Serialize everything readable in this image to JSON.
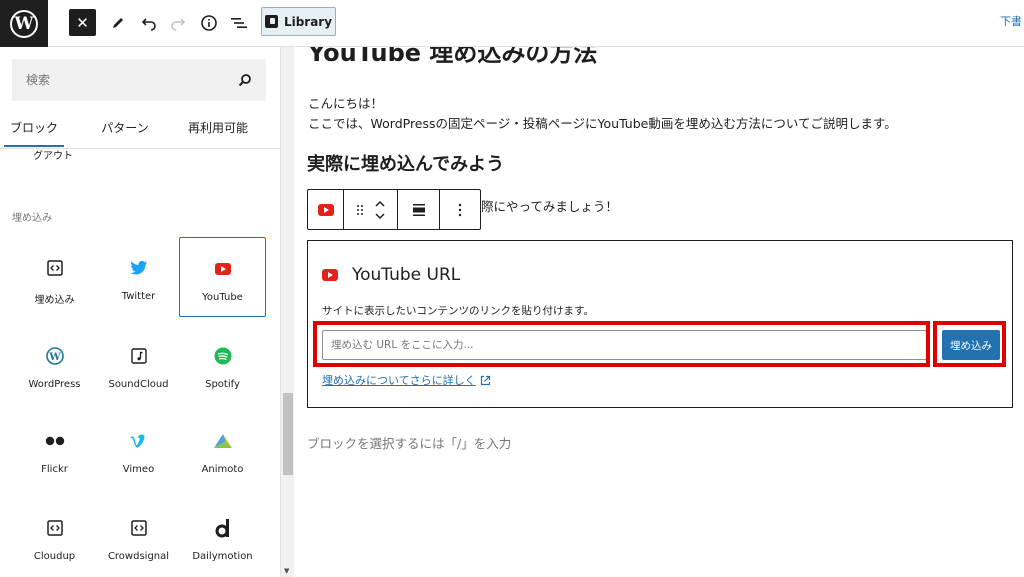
{
  "topbar": {
    "library_label": "Library",
    "draft_label": "下書"
  },
  "sidebar": {
    "search_placeholder": "検索",
    "tabs": [
      {
        "label": "ブロック",
        "active": true
      },
      {
        "label": "パターン",
        "active": false
      },
      {
        "label": "再利用可能",
        "active": false
      }
    ],
    "partial_label": "グアウト",
    "section_title": "埋め込み",
    "blocks": [
      {
        "label": "埋め込み",
        "icon": "embed-icon"
      },
      {
        "label": "Twitter",
        "icon": "twitter-icon"
      },
      {
        "label": "YouTube",
        "icon": "youtube-icon",
        "selected": true
      },
      {
        "label": "WordPress",
        "icon": "wordpress-icon"
      },
      {
        "label": "SoundCloud",
        "icon": "soundcloud-icon"
      },
      {
        "label": "Spotify",
        "icon": "spotify-icon"
      },
      {
        "label": "Flickr",
        "icon": "flickr-icon"
      },
      {
        "label": "Vimeo",
        "icon": "vimeo-icon"
      },
      {
        "label": "Animoto",
        "icon": "animoto-icon"
      },
      {
        "label": "Cloudup",
        "icon": "cloudup-icon"
      },
      {
        "label": "Crowdsignal",
        "icon": "crowdsignal-icon"
      },
      {
        "label": "Dailymotion",
        "icon": "dailymotion-icon"
      }
    ]
  },
  "editor": {
    "title_cut": "YouTube 埋め込みの方法",
    "intro_1": "こんにちは！",
    "intro_2": "ここでは、WordPressの固定ページ・投稿ページにYouTube動画を埋め込む方法についてご説明します。",
    "heading": "実際に埋め込んでみよう",
    "para_after_toolbar": "際にやってみましょう！",
    "embed": {
      "title": "YouTube URL",
      "description": "サイトに表示したいコンテンツのリンクを貼り付けます。",
      "input_placeholder": "埋め込む URL をここに入力...",
      "button_label": "埋め込み",
      "link_text": "埋め込みについてさらに詳しく"
    },
    "block_placeholder": "ブロックを選択するには「/」を入力"
  },
  "colors": {
    "accent": "#2271b1",
    "highlight": "#e00000",
    "youtube": "#e62117",
    "dark": "#1e1e1e"
  }
}
